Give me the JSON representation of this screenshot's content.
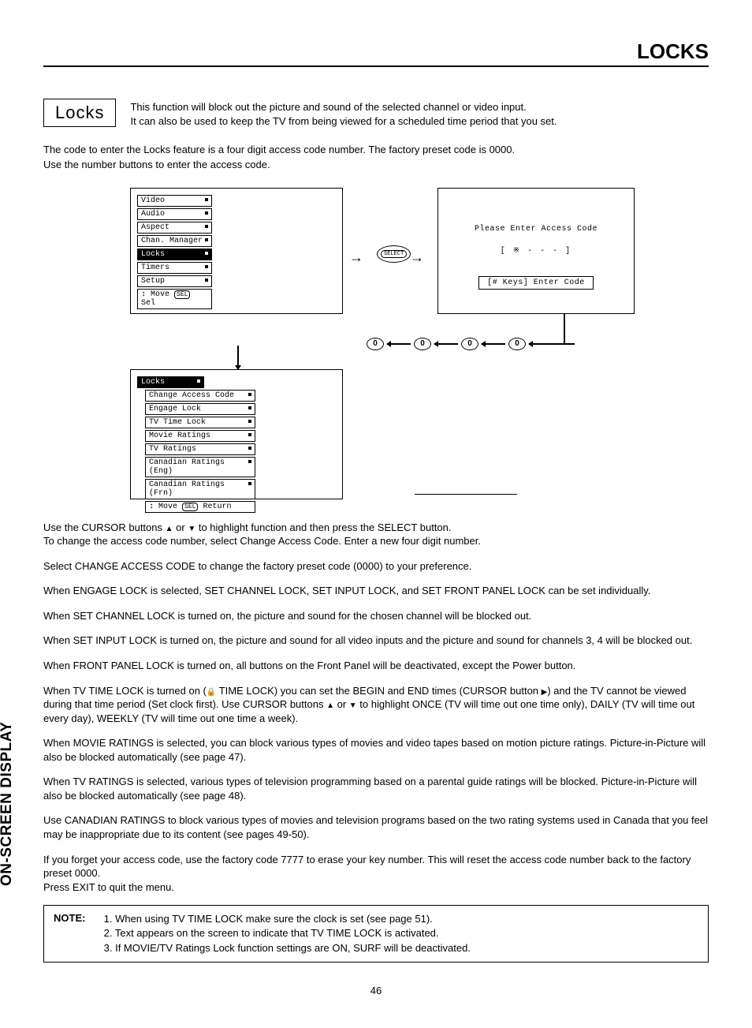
{
  "header": {
    "title": "LOCKS"
  },
  "section": {
    "label": "Locks",
    "desc_line1": "This function will block out the picture and sound of the selected channel or video input.",
    "desc_line2": "It can also be used to keep the TV from being viewed for a scheduled time period that you set."
  },
  "intro": {
    "line1": "The code to enter the Locks feature is a four digit access code number.  The factory preset code is 0000.",
    "line2": "Use the number buttons to enter the access code."
  },
  "main_menu": {
    "items": [
      "Video",
      "Audio",
      "Aspect",
      "Chan. Manager",
      "Locks",
      "Timers",
      "Setup"
    ],
    "highlighted": "Locks",
    "hint_prefix": "  Move ",
    "hint_suffix": " Sel",
    "sel_label": "SEL"
  },
  "select_button": "SELECT",
  "code_screen": {
    "line1": "Please Enter Access Code",
    "line2": "[ ※  -  -  - ]",
    "line3": "[# Keys] Enter Code"
  },
  "zero_label": "0",
  "locks_menu": {
    "header": "Locks",
    "items": [
      "Change Access Code",
      "Engage Lock",
      "TV Time Lock",
      "Movie Ratings",
      "TV Ratings",
      "Canadian Ratings (Eng)",
      "Canadian Ratings (Frn)"
    ],
    "hint_prefix": "  Move ",
    "hint_suffix": " Return",
    "sel_label": "SEL"
  },
  "body": {
    "p1a": "Use the CURSOR buttons ",
    "p1b": " or ",
    "p1c": " to highlight function and then press the SELECT button.",
    "p2": "To change the access code number, select Change Access Code.  Enter a new four digit number.",
    "p3": "Select CHANGE ACCESS CODE to change the factory preset code (0000) to your preference.",
    "p4": "When ENGAGE LOCK is selected, SET CHANNEL LOCK, SET INPUT LOCK, and SET FRONT PANEL LOCK can be set individually.",
    "p5": "When SET CHANNEL LOCK is turned on, the picture and sound for the chosen channel will be blocked out.",
    "p6": "When SET INPUT LOCK is turned on, the picture and sound for all video inputs and the picture and sound for channels 3, 4 will be blocked out.",
    "p7": "When FRONT PANEL LOCK is turned on, all buttons on the Front Panel will be deactivated, except the Power button.",
    "p8a": "When TV TIME LOCK is turned on (",
    "p8b": " TIME LOCK) you can set the BEGIN and END times (CURSOR button ",
    "p8c": ") and the TV cannot be viewed during that time period (Set clock first). Use CURSOR buttons ",
    "p8d": " or ",
    "p8e": " to highlight ONCE (TV will time out one time only), DAILY (TV will time out every day), WEEKLY (TV will time out one time a week).",
    "p9": "When MOVIE RATINGS is selected, you can block various types of movies and video tapes based on motion picture ratings.  Picture-in-Picture will also be blocked automatically (see page 47).",
    "p10": "When TV RATINGS is selected, various types of television programming based on a parental guide ratings will be blocked.  Picture-in-Picture will also be blocked automatically (see page 48).",
    "p11": "Use CANADIAN RATINGS to block various types of movies and television programs based on the two rating systems used in Canada that you feel may be inappropriate due to its content (see pages 49-50).",
    "p12": "If you forget your access code, use the factory code 7777 to erase your key number. This will reset the access code number back to the factory preset 0000.",
    "p13": "Press EXIT to quit the menu."
  },
  "note": {
    "label": "NOTE:",
    "items": [
      "1. When using TV TIME LOCK make sure the clock is set (see page 51).",
      "2. Text appears on the screen to indicate that TV TIME LOCK is activated.",
      "3. If MOVIE/TV Ratings Lock function settings are ON, SURF will be deactivated."
    ]
  },
  "side_label": "ON-SCREEN DISPLAY",
  "page_number": "46"
}
